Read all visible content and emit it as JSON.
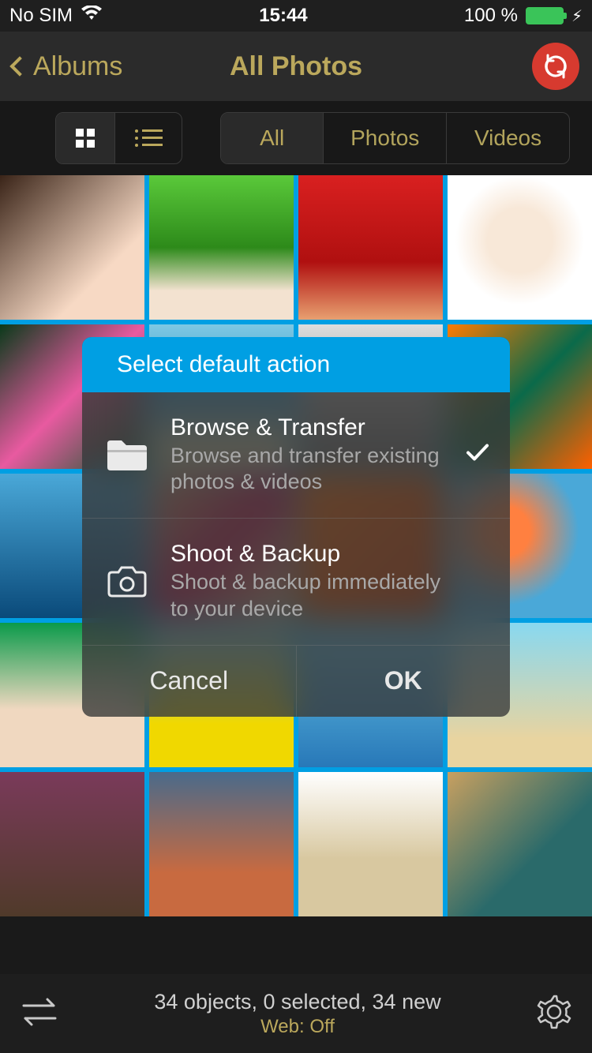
{
  "status": {
    "carrier": "No SIM",
    "time": "15:44",
    "battery_pct": "100 %"
  },
  "nav": {
    "back_label": "Albums",
    "title": "All Photos"
  },
  "filters": {
    "all": "All",
    "photos": "Photos",
    "videos": "Videos"
  },
  "dialog": {
    "title": "Select default action",
    "option1_title": "Browse & Transfer",
    "option1_sub": "Browse and transfer existing photos & videos",
    "option2_title": "Shoot & Backup",
    "option2_sub": "Shoot & backup immediately to your device",
    "cancel": "Cancel",
    "ok": "OK"
  },
  "bottom": {
    "line1": "34 objects, 0 selected, 34 new",
    "line2": "Web: Off"
  }
}
